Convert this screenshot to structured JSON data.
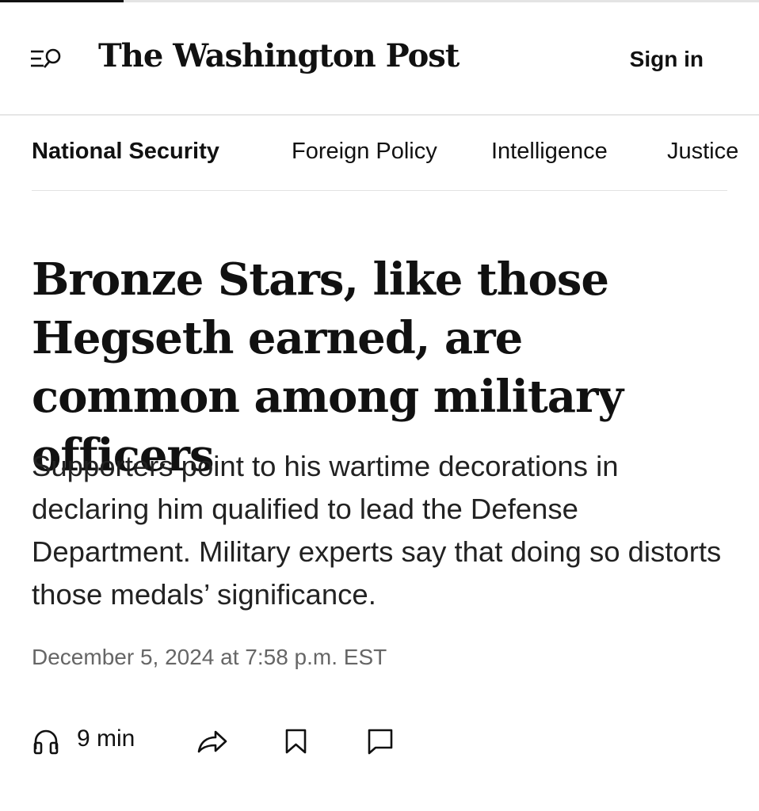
{
  "header": {
    "masthead": "The Washington Post",
    "sign_in_label": "Sign in",
    "menu_icon": "menu-search-icon"
  },
  "section_nav": {
    "items": [
      {
        "label": "National Security",
        "active": true
      },
      {
        "label": "Foreign Policy",
        "active": false
      },
      {
        "label": "Intelligence",
        "active": false
      },
      {
        "label": "Justice",
        "active": false
      }
    ]
  },
  "article": {
    "headline": "Bronze Stars, like those Hegseth earned, are common among military officers",
    "dek": "Supporters point to his wartime decorations in declaring him qualified to lead the Defense Department. Military experts say that doing so distorts those medals’ significance.",
    "dateline": "December 5, 2024 at 7:58 p.m. EST"
  },
  "actions": {
    "listen_icon": "headphones-icon",
    "listen_label": "9 min",
    "share_icon": "share-icon",
    "save_icon": "bookmark-icon",
    "comments_icon": "comment-icon"
  },
  "colors": {
    "text": "#111111",
    "dek": "#222222",
    "dateline": "#666666",
    "divider": "#e2e2e2",
    "background": "#ffffff"
  }
}
